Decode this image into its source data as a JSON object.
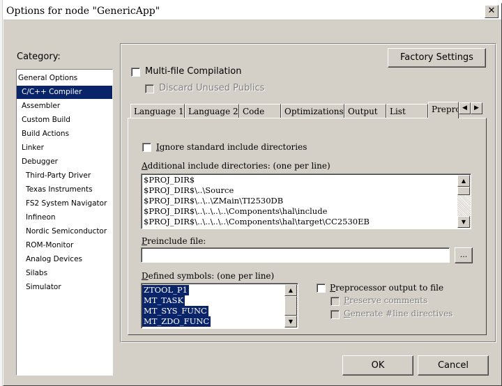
{
  "window": {
    "title": "Options for node \"GenericApp\"",
    "close_glyph": "✕"
  },
  "category": {
    "label": "Category:",
    "items": [
      {
        "label": "General Options",
        "selected": false
      },
      {
        "label": "C/C++ Compiler",
        "selected": true
      },
      {
        "label": "Assembler",
        "selected": false
      },
      {
        "label": "Custom Build",
        "selected": false
      },
      {
        "label": "Build Actions",
        "selected": false
      },
      {
        "label": "Linker",
        "selected": false
      },
      {
        "label": "Debugger",
        "selected": false
      },
      {
        "label": "Third-Party Driver",
        "selected": false
      },
      {
        "label": "Texas Instruments",
        "selected": false
      },
      {
        "label": "FS2 System Navigator",
        "selected": false
      },
      {
        "label": "Infineon",
        "selected": false
      },
      {
        "label": "Nordic Semiconductor",
        "selected": false
      },
      {
        "label": "ROM-Monitor",
        "selected": false
      },
      {
        "label": "Analog Devices",
        "selected": false
      },
      {
        "label": "Silabs",
        "selected": false
      },
      {
        "label": "Simulator",
        "selected": false
      }
    ]
  },
  "factory_settings_label": "Factory Settings",
  "multifile": {
    "label": "Multi-file Compilation",
    "checked": false
  },
  "discard": {
    "label": "Discard Unused Publics",
    "checked": false,
    "enabled": false
  },
  "tabs": [
    "Language 1",
    "Language 2",
    "Code",
    "Optimizations",
    "Output",
    "List",
    "Prepro"
  ],
  "active_tab": "Prepro",
  "tab_scroll": {
    "left": "◀",
    "right": "▶"
  },
  "preprocessor": {
    "ignore_std": {
      "label_u": "I",
      "label_rest": "gnore standard include directories",
      "checked": false
    },
    "additional_label_u": "A",
    "additional_label_rest": "dditional include directories: (one per line)",
    "include_dirs": [
      "$PROJ_DIR$",
      "$PROJ_DIR$\\..\\Source",
      "$PROJ_DIR$\\..\\..\\ZMain\\TI2530DB",
      "$PROJ_DIR$\\..\\..\\..\\..\\Components\\hal\\include",
      "$PROJ_DIR$\\..\\..\\..\\..\\Components\\hal\\target\\CC2530EB"
    ],
    "preinclude_label_u": "P",
    "preinclude_label_rest": "reinclude file:",
    "preinclude_value": "",
    "browse_label": "...",
    "defined_label_u": "D",
    "defined_label_rest": "efined symbols: (one per line)",
    "defined_symbols": [
      "ZTOOL_P1",
      "MT_TASK",
      "MT_SYS_FUNC",
      "MT_ZDO_FUNC"
    ],
    "pp_output": {
      "label_u": "P",
      "label_rest": "reprocessor output to file",
      "checked": false
    },
    "preserve_comments": {
      "label_u": "P",
      "label_rest": "reserve comments",
      "checked": false,
      "enabled": false
    },
    "line_directives": {
      "label_u": "G",
      "label_rest": "enerate #line directives",
      "checked": false,
      "enabled": false
    }
  },
  "scroll_glyphs": {
    "up": "▲",
    "down": "▼"
  },
  "ok_label": "OK",
  "cancel_label": "Cancel"
}
